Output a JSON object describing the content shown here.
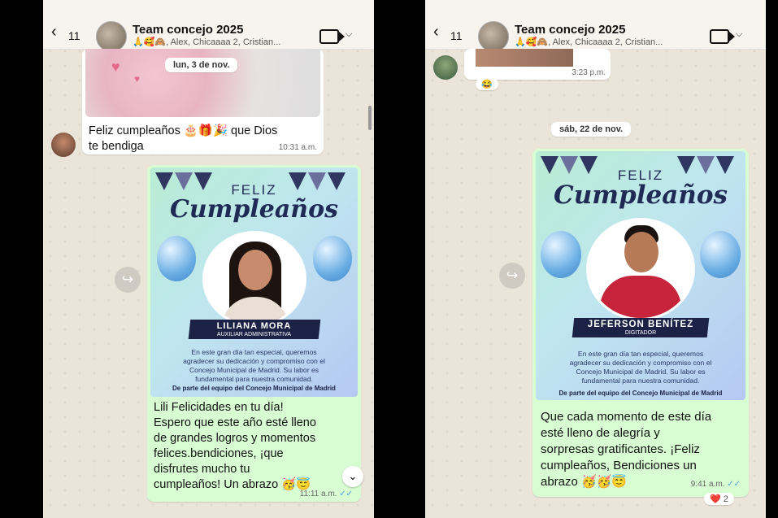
{
  "left_screen": {
    "header": {
      "back_count": "11",
      "group_name": "Team concejo 2025",
      "members": "🙏🥰🙈, Alex, Chicaaaa 2, Cristian..."
    },
    "date_divider": "lun, 3 de nov.",
    "incoming": {
      "text_line1": "Feliz cumpleaños 🎂🎁🎉 que Dios",
      "text_line2": "te bendiga",
      "time": "10:31 a.m."
    },
    "card": {
      "feliz": "FELIZ",
      "cumpleanos": "Cumpleaños",
      "name": "LILIANA MORA",
      "role": "AUXILIAR ADMINISTRATIVA",
      "body": [
        "En este gran día tan especial, queremos",
        "agradecer su dedicación y compromiso con el",
        "Concejo Municipal de Madrid. Su labor es",
        "fundamental para nuestra comunidad."
      ],
      "footer": "De parte del equipo del Concejo Municipal de Madrid"
    },
    "outgoing": {
      "lines": [
        "Lili Felicidades en tu día!",
        "Espero que este año esté lleno",
        "de grandes logros y momentos",
        "felices.bendiciones, ¡que",
        "disfrutes mucho tu",
        "cumpleaños! Un abrazo 🥳😇"
      ],
      "time": "11:11 a.m.",
      "ticks": "✓✓"
    },
    "forward_icon": "↪",
    "scroll_down": "⌄"
  },
  "right_screen": {
    "header": {
      "back_count": "11",
      "group_name": "Team concejo 2025",
      "members": "🙏🥰🙈, Alex, Chicaaaa 2, Cristian..."
    },
    "prev": {
      "time": "3:23 p.m.",
      "reaction": "😂"
    },
    "date_divider": "sáb, 22 de nov.",
    "card": {
      "feliz": "FELIZ",
      "cumpleanos": "Cumpleaños",
      "name": "JEFERSON BENÍTEZ",
      "role": "DIGITADOR",
      "body": [
        "En este gran día tan especial, queremos",
        "agradecer su dedicación y compromiso con el",
        "Concejo Municipal de Madrid. Su labor es",
        "fundamental para nuestra comunidad."
      ],
      "footer": "De parte del equipo del Concejo Municipal de Madrid"
    },
    "outgoing": {
      "lines": [
        "Que cada momento de este día",
        "esté lleno de alegría y",
        "sorpresas gratificantes. ¡Feliz",
        "cumpleaños, Bendiciones un",
        "abrazo 🥳🥳😇"
      ],
      "time": "9:41 a.m.",
      "ticks": "✓✓"
    },
    "reaction": {
      "emoji": "❤️",
      "count": "2"
    },
    "forward_icon": "↪"
  },
  "colors": {
    "outgoing_bubble": "#d9fdd3",
    "incoming_bubble": "#ffffff",
    "chat_bg": "#ebe4d8",
    "card_navy": "#1f2a55"
  }
}
